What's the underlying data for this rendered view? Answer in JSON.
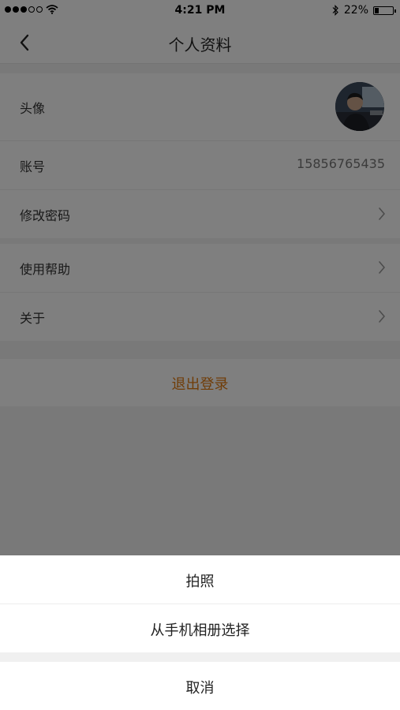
{
  "status_bar": {
    "time": "4:21 PM",
    "battery": "22%",
    "battery_level": 0.22,
    "signal_bars_filled": 3,
    "signal_bars_total": 5,
    "icons": [
      "signal-dots-icon",
      "wifi-icon",
      "bluetooth-icon",
      "battery-icon"
    ]
  },
  "nav": {
    "title": "个人资料",
    "back_icon": "chevron-left-icon"
  },
  "profile": {
    "avatar_label": "头像",
    "account_label": "账号",
    "account_value": "15856765435",
    "change_password_label": "修改密码"
  },
  "misc": {
    "help_label": "使用帮助",
    "about_label": "关于"
  },
  "logout_label": "退出登录",
  "action_sheet": {
    "take_photo": "拍照",
    "choose_album": "从手机相册选择",
    "cancel": "取消"
  },
  "colors": {
    "accent": "#e07a10",
    "overlay": "rgba(0,0,0,0.5)"
  }
}
